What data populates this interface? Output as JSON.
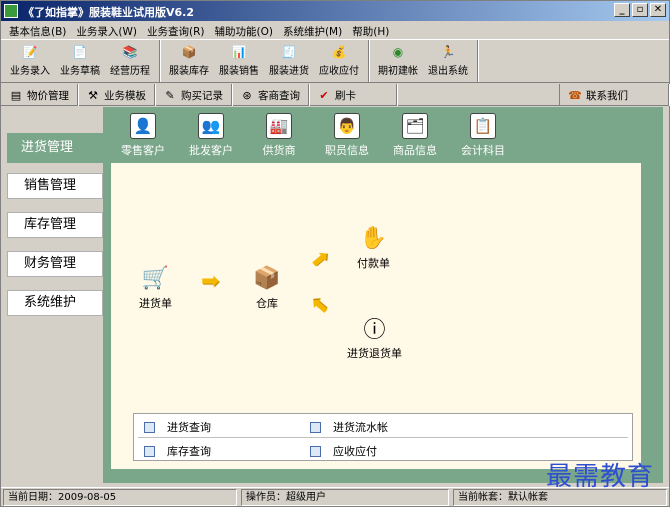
{
  "window": {
    "title": "《了如指掌》服装鞋业试用版V6.2",
    "controls": [
      "_",
      "▫",
      "✕"
    ]
  },
  "menu": [
    "基本信息(B)",
    "业务录入(W)",
    "业务查询(R)",
    "辅助功能(O)",
    "系统维护(M)",
    "帮助(H)"
  ],
  "toolbar": {
    "group1": [
      {
        "label": "业务录入",
        "icon": "document-entry-icon",
        "glyph": "📝"
      },
      {
        "label": "业务草稿",
        "icon": "draft-icon",
        "glyph": "📄"
      },
      {
        "label": "经营历程",
        "icon": "history-icon",
        "glyph": "📚"
      }
    ],
    "group2": [
      {
        "label": "服装库存",
        "icon": "inventory-icon",
        "glyph": "📦"
      },
      {
        "label": "服装销售",
        "icon": "sales-icon",
        "glyph": "📊"
      },
      {
        "label": "服装进货",
        "icon": "purchase-icon",
        "glyph": "🧾"
      },
      {
        "label": "应收应付",
        "icon": "receivable-icon",
        "glyph": "💰"
      }
    ],
    "group3": [
      {
        "label": "期初建帐",
        "icon": "opening-account-icon",
        "glyph": "◉"
      },
      {
        "label": "退出系统",
        "icon": "exit-icon",
        "glyph": "🏃"
      }
    ]
  },
  "toolbar2": [
    {
      "label": "物价管理",
      "icon": "price-icon",
      "glyph": "▤"
    },
    {
      "label": "业务模板",
      "icon": "template-icon",
      "glyph": "⚒"
    },
    {
      "label": "购买记录",
      "icon": "purchase-record-icon",
      "glyph": "✎"
    },
    {
      "label": "客商查询",
      "icon": "customer-query-icon",
      "glyph": "⊛"
    },
    {
      "label": "刷卡",
      "icon": "card-swipe-icon",
      "glyph": "✔"
    }
  ],
  "contact": {
    "label": "联系我们",
    "icon": "contact-icon",
    "glyph": "☎"
  },
  "nav": {
    "active": "进货管理",
    "items": [
      "销售管理",
      "库存管理",
      "财务管理",
      "系统维护"
    ]
  },
  "top_icons": [
    {
      "label": "零售客户",
      "icon": "retail-customer-icon",
      "glyph": "👤"
    },
    {
      "label": "批发客户",
      "icon": "wholesale-customer-icon",
      "glyph": "👥"
    },
    {
      "label": "供货商",
      "icon": "supplier-icon",
      "glyph": "🏭"
    },
    {
      "label": "职员信息",
      "icon": "staff-icon",
      "glyph": "👨"
    },
    {
      "label": "商品信息",
      "icon": "goods-icon",
      "glyph": "🗂"
    },
    {
      "label": "会计科目",
      "icon": "account-subject-icon",
      "glyph": "📋"
    }
  ],
  "flow": {
    "purchase_order": "进货单",
    "warehouse": "仓库",
    "payment": "付款单",
    "purchase_return": "进货退货单"
  },
  "queries": [
    "进货查询",
    "进货流水帐",
    "库存查询",
    "应收应付"
  ],
  "status": {
    "date": "当前日期：2009-08-05",
    "operator": "操作员：超级用户",
    "account": "当前帐套：默认帐套"
  },
  "watermark": "最需教育",
  "colors": {
    "main_bg": "#7aa68a",
    "workspace_bg": "#fff9e8",
    "titlebar": "#0a246a"
  }
}
